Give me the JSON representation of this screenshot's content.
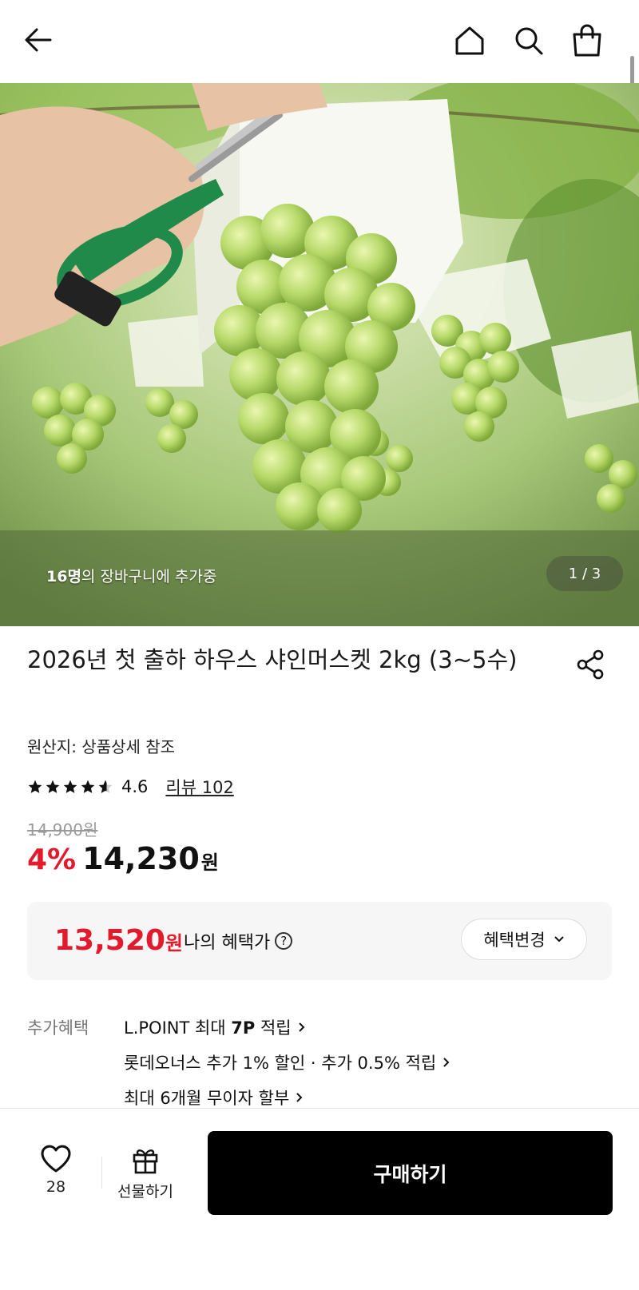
{
  "header": {
    "back_icon": "arrow-left-icon",
    "home_icon": "home-icon",
    "search_icon": "search-icon",
    "cart_icon": "shopping-bag-icon"
  },
  "hero": {
    "caption_count": "16명",
    "caption_rest": "의 장바구니에 추가중",
    "pager": "1 / 3"
  },
  "product": {
    "title": "2026년 첫 출하 하우스 샤인머스켓 2kg (3~5수)",
    "origin": "원산지: 상품상세 참조",
    "rating": "4.6",
    "rating_fraction": 0.92,
    "review_label": "리뷰 102",
    "original_price": "14,900원",
    "discount": "4%",
    "price": "14,230",
    "price_unit": "원"
  },
  "benefit": {
    "price": "13,520",
    "price_unit": "원",
    "label": "나의 혜택가",
    "help_icon": "question-circle-icon",
    "change_button": "혜택변경"
  },
  "extra_benefits": {
    "label": "추가혜택",
    "items": [
      {
        "prefix": "L.POINT 최대 ",
        "bold": "7P",
        "suffix": " 적립"
      },
      {
        "prefix": "롯데오너스 추가 1% 할인 · 추가 0.5% 적립",
        "bold": "",
        "suffix": ""
      },
      {
        "prefix": "최대 6개월 무이자 할부",
        "bold": "",
        "suffix": ""
      }
    ]
  },
  "bottom": {
    "wish_count": "28",
    "gift_label": "선물하기",
    "buy_label": "구매하기"
  },
  "colors": {
    "accent_red": "#e3192c",
    "buy_button": "#000000",
    "grape": "#b7d96a"
  }
}
